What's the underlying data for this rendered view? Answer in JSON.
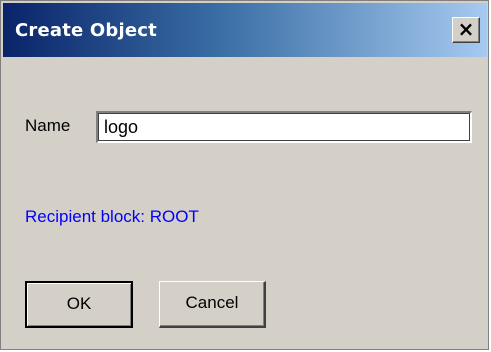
{
  "dialog": {
    "title": "Create Object",
    "close_icon": "close-icon",
    "close_glyph": "✕"
  },
  "form": {
    "name_label": "Name",
    "name_value": "logo",
    "recipient_text": "Recipient block: ROOT"
  },
  "buttons": {
    "ok_label": "OK",
    "cancel_label": "Cancel"
  },
  "colors": {
    "title_bar_start": "#0a246a",
    "title_bar_end": "#a6caf0",
    "dialog_bg": "#d4d0c8",
    "recipient_text": "#0000ff"
  }
}
